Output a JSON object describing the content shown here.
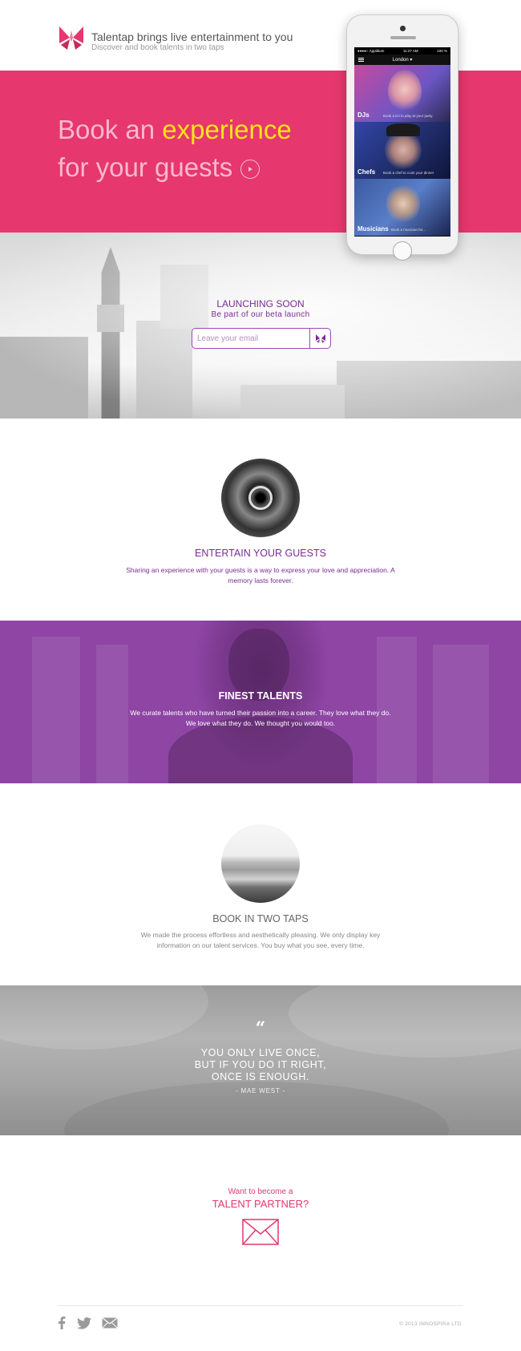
{
  "header": {
    "title": "Talentap brings live entertainment to you",
    "subtitle": "Discover and book talents in two taps"
  },
  "hero": {
    "line1_prefix": "Book an ",
    "line1_highlight": "experience",
    "line2": "for your guests",
    "colors": {
      "background": "#e6376e",
      "highlight": "#ffe21a",
      "text": "#f8b9cf"
    }
  },
  "phone": {
    "status_left": "●●●●○ Appldium",
    "status_time": "11:27 AM",
    "status_right": "100 %",
    "location": "London ▾",
    "tiles": [
      {
        "name": "DJs",
        "desc": "Book a DJ to play at your party"
      },
      {
        "name": "Chefs",
        "desc": "Book a chef to cook your dinner"
      },
      {
        "name": "Musicians",
        "desc": "Book a musician for..."
      }
    ]
  },
  "launch": {
    "title": "LAUNCHING SOON",
    "subtitle": "Be part of our beta launch",
    "email_placeholder": "Leave your email"
  },
  "entertain": {
    "title": "ENTERTAIN YOUR GUESTS",
    "text": "Sharing an experience with your guests is a way to express your love and appreciation. A memory lasts forever."
  },
  "finest": {
    "title": "FINEST TALENTS",
    "text": "We curate talents who have turned their passion into a career. They love what they do. We love what they do. We thought you would too."
  },
  "book": {
    "title": "BOOK IN TWO TAPS",
    "text": "We made the process effortless and aesthetically pleasing. We only display key information on our talent services. You buy what you see, every time."
  },
  "quote": {
    "mark": "“",
    "lines": [
      "YOU ONLY LIVE ONCE,",
      "BUT IF YOU DO IT RIGHT,",
      "ONCE IS ENOUGH."
    ],
    "author": "- MAE WEST -"
  },
  "partner": {
    "small": "Want to become a",
    "big": "TALENT PARTNER?"
  },
  "footer": {
    "social_icons": [
      "facebook-icon",
      "twitter-icon",
      "mail-icon"
    ],
    "copyright": "© 2013 INNOSPIRA LTD."
  },
  "colors": {
    "purple": "#7b2b95",
    "purple_band": "#8e45a4",
    "pink": "#e6376e",
    "gray_text": "#666666"
  }
}
